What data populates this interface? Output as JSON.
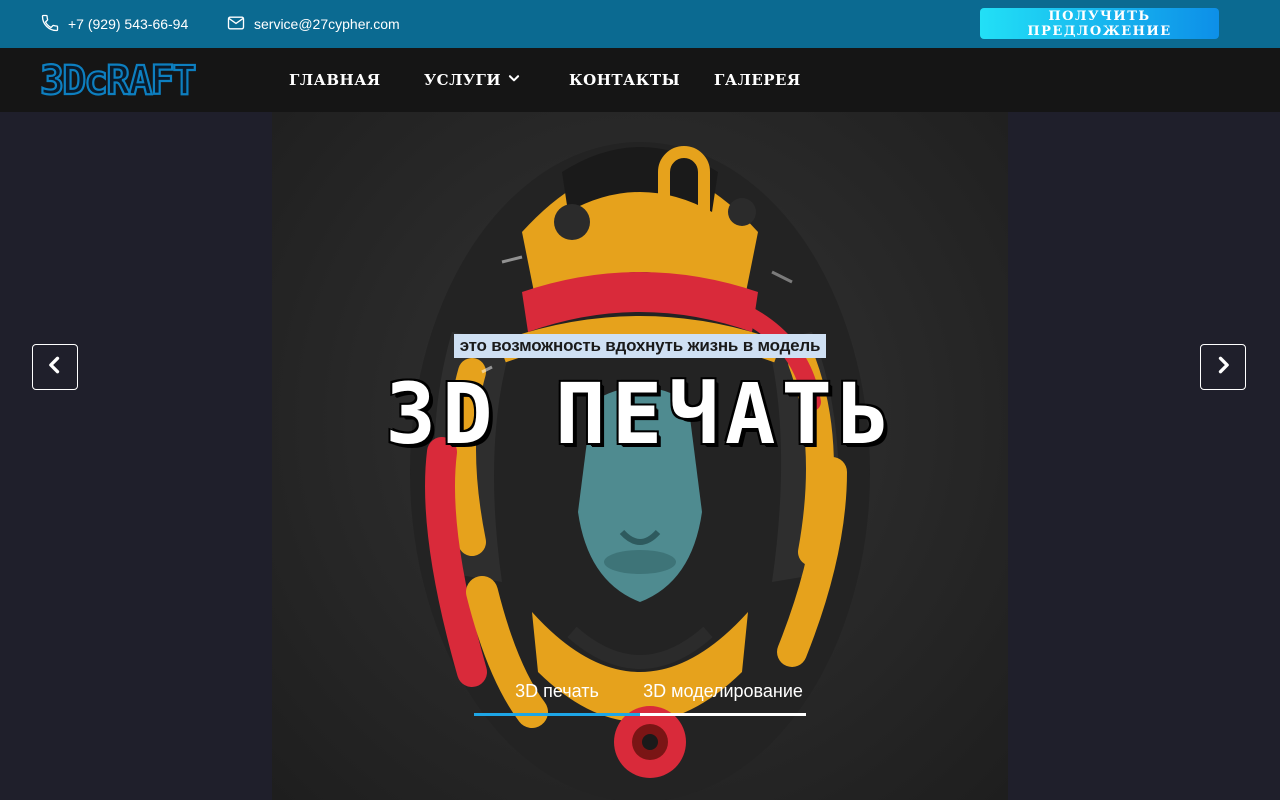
{
  "topbar": {
    "phone": "+7 (929) 543-66-94",
    "email": "service@27cypher.com",
    "cta_label": "ПОЛУЧИТЬ ПРЕДЛОЖЕНИЕ",
    "background_color": "#0b6a91",
    "phone_icon": "phone-icon",
    "email_icon": "mail-icon"
  },
  "logo": {
    "text": "3DcRAFT",
    "color": "#0d7fc0"
  },
  "nav": {
    "items": [
      {
        "label": "ГЛАВНАЯ"
      },
      {
        "label": "УСЛУГИ",
        "has_dropdown": true
      },
      {
        "label": "КОНТАКТЫ"
      },
      {
        "label": "ГАЛЕРЕЯ"
      }
    ]
  },
  "hero": {
    "tagline": "это возможность вдохнуть жизнь в модель",
    "headline": "3D ПЕЧАТЬ",
    "tabs": [
      {
        "label": "3D печать",
        "active": true
      },
      {
        "label": "3D моделирование",
        "active": false
      }
    ],
    "accent_color": "#1ea6e6"
  }
}
